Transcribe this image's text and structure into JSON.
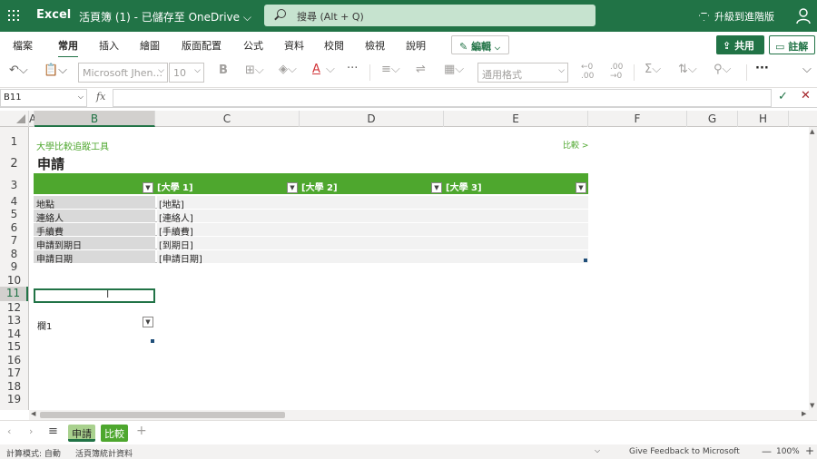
{
  "titlebar": {
    "app_name": "Excel",
    "doc_title": "活頁簿 (1) - 已儲存至 OneDrive ⌵",
    "search_placeholder": "搜尋 (Alt + Q)",
    "upgrade_label": "升級到進階版"
  },
  "menu": {
    "tabs": [
      "檔案",
      "常用",
      "插入",
      "繪圖",
      "版面配置",
      "公式",
      "資料",
      "校閱",
      "檢視",
      "說明"
    ],
    "active_tab": "常用",
    "edit_label": "編輯",
    "share_label": "共用",
    "comment_label": "註解"
  },
  "toolbar": {
    "font_name": "Microsoft Jhen...",
    "font_size": "10",
    "number_format": "通用格式",
    "bold_label": "B",
    "font_color_label": "A",
    "more_label": "···"
  },
  "formula_bar": {
    "name_box": "B11",
    "fx_label": "fx",
    "formula": ""
  },
  "grid": {
    "columns": [
      "A",
      "B",
      "C",
      "D",
      "E",
      "F",
      "G",
      "H"
    ],
    "selected_column": "B",
    "rows": [
      "1",
      "2",
      "3",
      "4",
      "5",
      "6",
      "7",
      "8",
      "9",
      "10",
      "11",
      "12",
      "13",
      "14",
      "15",
      "16",
      "17",
      "18",
      "19"
    ],
    "selected_row": "11"
  },
  "sheet": {
    "subtitle": "大學比較追蹤工具",
    "compare_link": "比較 >",
    "title": "申請",
    "table_headers": [
      "",
      "[大學 1]",
      "[大學 2]",
      "[大學 3]"
    ],
    "table_rows": [
      {
        "label": "地點",
        "value": "[地點]"
      },
      {
        "label": "連絡人",
        "value": "[連絡人]"
      },
      {
        "label": "手續費",
        "value": "[手續費]"
      },
      {
        "label": "申請到期日",
        "value": "[到期日]"
      },
      {
        "label": "申請日期",
        "value": "[申請日期]"
      }
    ],
    "second_table_header": "欄1"
  },
  "sheet_tabs": {
    "tabs": [
      "申請",
      "比較"
    ],
    "active_tab": "申請",
    "colors": {
      "active": "#a9d18e",
      "second": "#4ea72e"
    }
  },
  "statusbar": {
    "calc_mode": "計算模式: 自動",
    "stats": "活頁簿統計資料",
    "feedback": "Give Feedback to Microsoft",
    "zoom": "100%"
  },
  "colors": {
    "brand": "#217346",
    "table_header": "#4ea72e",
    "label_fill": "#d9d9d9",
    "value_fill": "#f2f2f2"
  }
}
